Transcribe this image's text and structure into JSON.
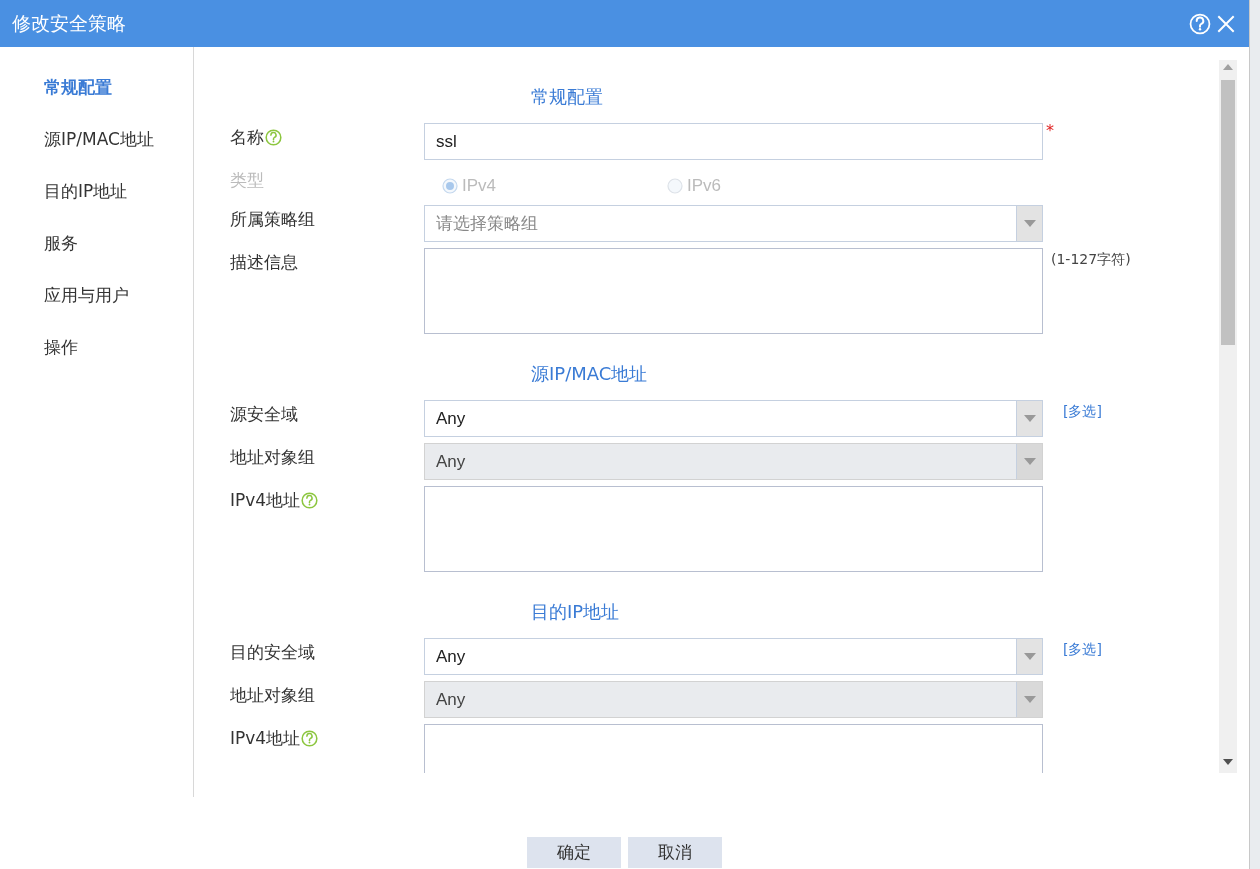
{
  "window": {
    "title": "修改安全策略"
  },
  "sidebar": {
    "items": [
      {
        "label": "常规配置",
        "selected": true
      },
      {
        "label": "源IP/MAC地址",
        "selected": false
      },
      {
        "label": "目的IP地址",
        "selected": false
      },
      {
        "label": "服务",
        "selected": false
      },
      {
        "label": "应用与用户",
        "selected": false
      },
      {
        "label": "操作",
        "selected": false
      }
    ]
  },
  "sections": [
    {
      "title": "常规配置",
      "rows": [
        {
          "kind": "text",
          "label": "名称",
          "help": true,
          "value": "ssl",
          "required_mark": "*"
        },
        {
          "kind": "radio",
          "label": "类型",
          "disabled": true,
          "options": [
            {
              "label": "IPv4",
              "selected": true
            },
            {
              "label": "IPv6",
              "selected": false
            }
          ]
        },
        {
          "kind": "select",
          "label": "所属策略组",
          "placeholder": "请选择策略组",
          "disabled": false
        },
        {
          "kind": "textarea",
          "label": "描述信息",
          "note": "(1-127字符)"
        }
      ]
    },
    {
      "title": "源IP/MAC地址",
      "rows": [
        {
          "kind": "select",
          "label": "源安全域",
          "value": "Any",
          "disabled": false,
          "link": "[多选]"
        },
        {
          "kind": "select",
          "label": "地址对象组",
          "value": "Any",
          "disabled": true
        },
        {
          "kind": "textarea",
          "label": "IPv4地址",
          "help": true
        }
      ]
    },
    {
      "title": "目的IP地址",
      "rows": [
        {
          "kind": "select",
          "label": "目的安全域",
          "value": "Any",
          "disabled": false,
          "link": "[多选]"
        },
        {
          "kind": "select",
          "label": "地址对象组",
          "value": "Any",
          "disabled": true
        },
        {
          "kind": "textarea",
          "label": "IPv4地址",
          "help": true
        }
      ]
    }
  ],
  "buttons": [
    "确定",
    "取消"
  ]
}
